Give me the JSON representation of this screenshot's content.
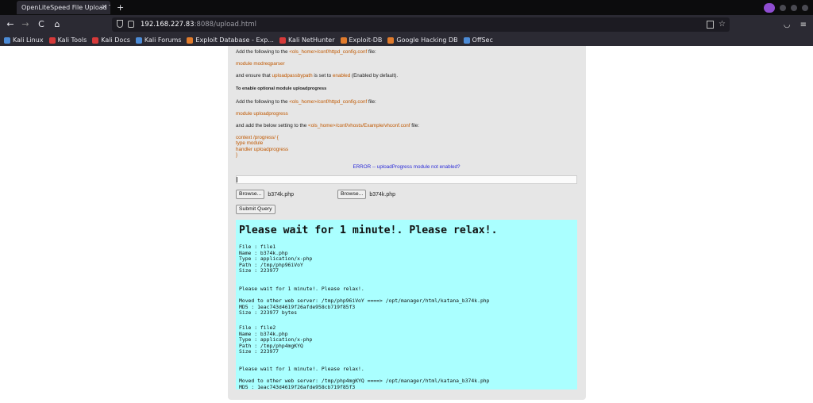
{
  "browser": {
    "tab_title": "OpenLiteSpeed File Upload T",
    "tab_close": "×",
    "new_tab": "+",
    "url_host": "192.168.227.83",
    "url_rest": ":8088/upload.html",
    "nav_back": "←",
    "nav_forward": "→",
    "nav_reload": "C",
    "nav_home": "⌂",
    "star": "☆"
  },
  "bookmarks": [
    {
      "label": "Kali Linux",
      "color": "#4c8bd6"
    },
    {
      "label": "Kali Tools",
      "color": "#d63a3a"
    },
    {
      "label": "Kali Docs",
      "color": "#d63a3a"
    },
    {
      "label": "Kali Forums",
      "color": "#4c8bd6"
    },
    {
      "label": "Exploit Database - Exp...",
      "color": "#e07b2c"
    },
    {
      "label": "Kali NetHunter",
      "color": "#d63a3a"
    },
    {
      "label": "Exploit-DB",
      "color": "#e07b2c"
    },
    {
      "label": "Google Hacking DB",
      "color": "#e07b2c"
    },
    {
      "label": "OffSec",
      "color": "#4c8bd6"
    }
  ],
  "instructions": {
    "l1_pre": "Add the following to the ",
    "l1_link": "<ols_home>/conf/httpd_config.conf",
    "l1_post": " file:",
    "l2": "module modreqparser",
    "l3_pre": "and ensure that ",
    "l3_link1": "uploadpassbypath",
    "l3_mid": " is set to ",
    "l3_link2": "enabled",
    "l3_post": " (Enabled by default).",
    "heading": "To enable optional module uploadprogress",
    "l4_pre": "Add the following to the ",
    "l4_link": "<ols_home>/conf/httpd_config.conf",
    "l4_post": " file:",
    "l5": "module uploadprogress",
    "l6_pre": "and add the below setting to the ",
    "l6_link": "<ols_home>/conf/vhosts/Example/vhconf.conf",
    "l6_post": " file:",
    "c1": "context /progress/ {",
    "c2": "type module",
    "c3": "handler uploadprogress",
    "c4": "}",
    "error": "ERROR -- uploadProgress module not enabled?"
  },
  "form": {
    "browse_label": "Browse...",
    "file1": "b374k.php",
    "file2": "b374k.php",
    "submit_label": "Submit Query"
  },
  "result": {
    "title": "Please wait for 1 minute!. Please relax!.",
    "block1": "File : file1\nName : b374k.php\nType : application/x-php\nPath : /tmp/php96iVoY\nSize : 223977",
    "wait1": "Please wait for 1 minute!. Please relax!.",
    "block2": "Moved to other web server: /tmp/php96iVoY ====> /opt/manager/html/katana_b374k.php\nMD5 : 1eac743d4619f26afde958cb719f85f3\nSize : 223977 bytes",
    "block3": "File : file2\nName : b374k.php\nType : application/x-php\nPath : /tmp/php4mgKYQ\nSize : 223977",
    "wait2": "Please wait for 1 minute!. Please relax!.",
    "block4": "Moved to other web server: /tmp/php4mgKYQ ====> /opt/manager/html/katana_b374k.php\nMD5 : 1eac743d4619f26afde958cb719f85f3"
  }
}
